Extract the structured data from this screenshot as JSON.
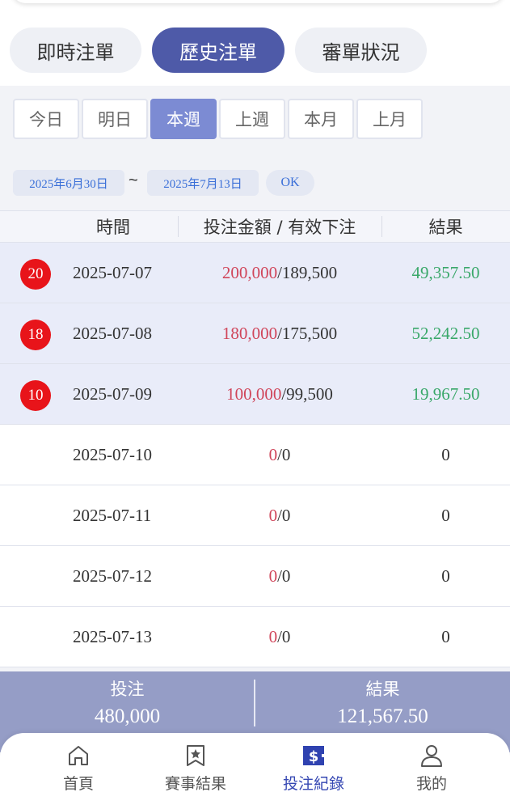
{
  "main_tabs": [
    {
      "label": "即時注單",
      "active": false
    },
    {
      "label": "歷史注單",
      "active": true
    },
    {
      "label": "審單狀況",
      "active": false
    }
  ],
  "periods": [
    {
      "label": "今日",
      "active": false
    },
    {
      "label": "明日",
      "active": false
    },
    {
      "label": "本週",
      "active": true
    },
    {
      "label": "上週",
      "active": false
    },
    {
      "label": "本月",
      "active": false
    },
    {
      "label": "上月",
      "active": false
    }
  ],
  "date_range": {
    "start": "2025年6月30日",
    "separator": "~",
    "end": "2025年7月13日",
    "ok_label": "OK"
  },
  "table": {
    "headers": {
      "time": "時間",
      "amount": "投注金額 / 有效下注",
      "result": "結果"
    },
    "rows": [
      {
        "badge": "20",
        "date": "2025-07-07",
        "bet": "200,000",
        "effective": "/189,500",
        "result": "49,357.50",
        "highlight": true
      },
      {
        "badge": "18",
        "date": "2025-07-08",
        "bet": "180,000",
        "effective": "/175,500",
        "result": "52,242.50",
        "highlight": true
      },
      {
        "badge": "10",
        "date": "2025-07-09",
        "bet": "100,000",
        "effective": "/99,500",
        "result": "19,967.50",
        "highlight": true
      },
      {
        "badge": "",
        "date": "2025-07-10",
        "bet": "0",
        "effective": "/0",
        "result": "0",
        "highlight": false
      },
      {
        "badge": "",
        "date": "2025-07-11",
        "bet": "0",
        "effective": "/0",
        "result": "0",
        "highlight": false
      },
      {
        "badge": "",
        "date": "2025-07-12",
        "bet": "0",
        "effective": "/0",
        "result": "0",
        "highlight": false
      },
      {
        "badge": "",
        "date": "2025-07-13",
        "bet": "0",
        "effective": "/0",
        "result": "0",
        "highlight": false
      }
    ]
  },
  "summary": {
    "bet_label": "投注",
    "bet_value": "480,000",
    "result_label": "結果",
    "result_value": "121,567.50"
  },
  "bottom_nav": [
    {
      "label": "首頁",
      "icon": "home-icon",
      "active": false
    },
    {
      "label": "賽事結果",
      "icon": "star-badge-icon",
      "active": false
    },
    {
      "label": "投注紀錄",
      "icon": "dollar-icon",
      "active": true
    },
    {
      "label": "我的",
      "icon": "user-icon",
      "active": false
    }
  ],
  "colors": {
    "primary": "#4e5aa8",
    "bet_red": "#d0455a",
    "win_green": "#3aa86a",
    "badge_red": "#e8141a",
    "summary_bg": "#959dc6"
  }
}
